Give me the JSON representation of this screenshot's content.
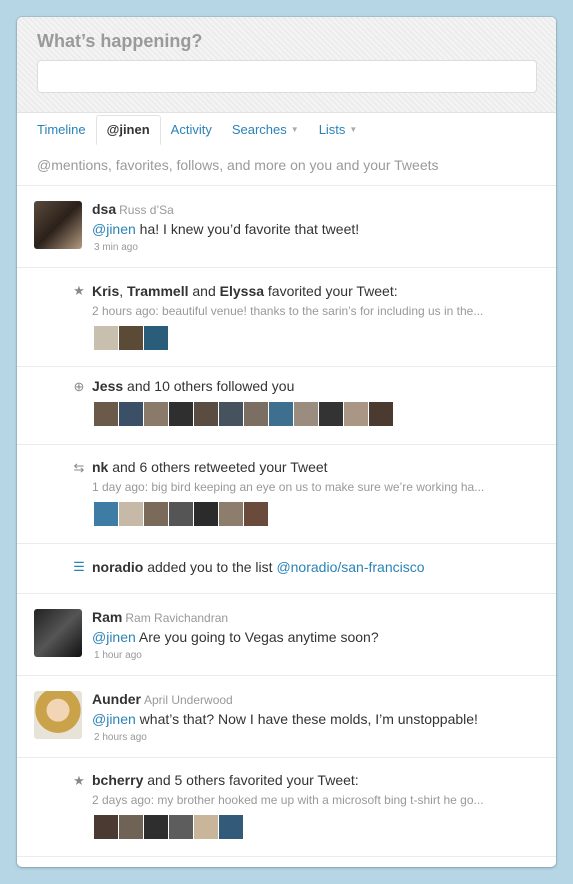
{
  "compose": {
    "title": "What’s happening?",
    "input_value": ""
  },
  "tabs": [
    {
      "label": "Timeline"
    },
    {
      "label": "@jinen"
    },
    {
      "label": "Activity"
    },
    {
      "label": "Searches"
    },
    {
      "label": "Lists"
    }
  ],
  "subtitle": "@mentions, favorites, follows, and more on you and your Tweets",
  "items": [
    {
      "username": "dsa",
      "fullname": "Russ d’Sa",
      "mention": "@jinen",
      "text": " ha! I knew you’d favorite that tweet!",
      "time": "3 min ago"
    },
    {
      "icon": "star-icon",
      "u1": "Kris",
      "u2": "Trammell",
      "u3": "Elyssa",
      "mid1": ", ",
      "mid2": " and ",
      "tail": " favorited your Tweet:",
      "sub": "2 hours ago: beautiful venue! thanks to the sarin’s for including us in the..."
    },
    {
      "icon": "follow-plus-icon",
      "u1": "Jess",
      "tail": " and 10 others followed you"
    },
    {
      "icon": "retweet-icon",
      "u1": "nk",
      "tail": " and 6 others retweeted your Tweet",
      "sub": "1 day ago: big bird keeping an eye on us to make sure we’re working ha..."
    },
    {
      "icon": "list-icon",
      "u1": "noradio",
      "tail": " added you to the list ",
      "link": "@noradio/san-francisco"
    },
    {
      "username": "Ram",
      "fullname": "Ram Ravichandran",
      "mention": "@jinen",
      "text": " Are you going to Vegas anytime soon?",
      "time": "1 hour ago"
    },
    {
      "username": "Aunder",
      "fullname": "April Underwood",
      "mention": "@jinen",
      "text": " what’s that? Now I have these molds, I’m unstoppable!",
      "time": "2 hours ago"
    },
    {
      "icon": "star-icon",
      "u1": "bcherry",
      "tail": " and 5 others favorited your Tweet:",
      "sub": "2 days ago: my brother hooked me up with a microsoft bing t-shirt he go..."
    }
  ],
  "colors": {
    "link": "#2a83b6",
    "background": "#b6d6e6"
  }
}
